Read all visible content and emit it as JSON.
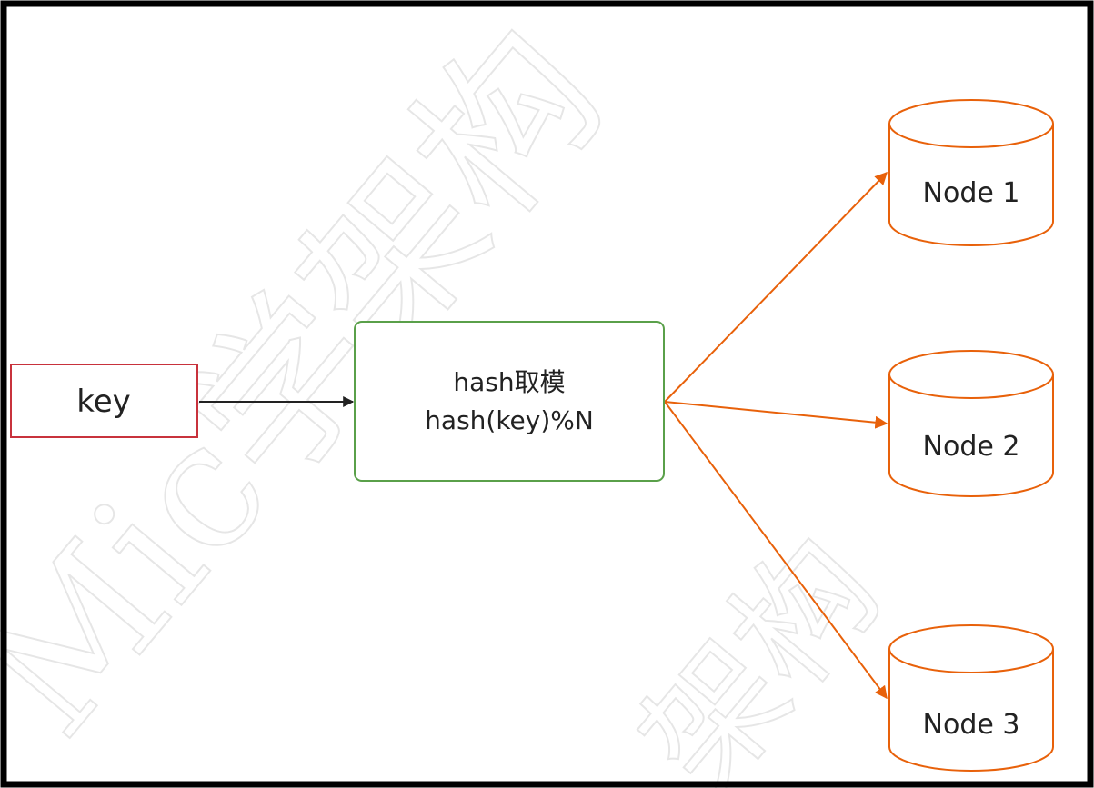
{
  "watermark": {
    "text_1": "Mic学架构",
    "text_2": "架构"
  },
  "nodes": {
    "key": {
      "label": "key"
    },
    "hash": {
      "line1": "hash取模",
      "line2": "hash(key)%N"
    },
    "node1": {
      "label": "Node 1"
    },
    "node2": {
      "label": "Node 2"
    },
    "node3": {
      "label": "Node 3"
    }
  },
  "colors": {
    "frame": "#000000",
    "key_border": "#c8323c",
    "hash_border": "#5aa04a",
    "db_border": "#e8610a",
    "edge_default": "#222222",
    "edge_highlight": "#e8610a"
  }
}
